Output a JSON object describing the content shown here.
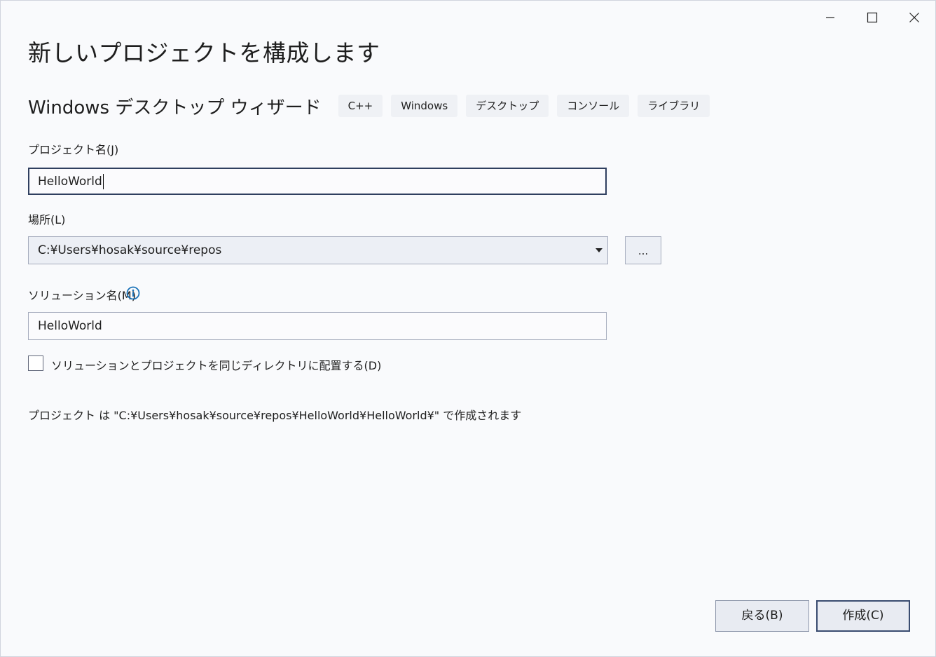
{
  "dialog": {
    "title": "新しいプロジェクトを構成します",
    "wizard_name": "Windows デスクトップ ウィザード",
    "tags": [
      "C++",
      "Windows",
      "デスクトップ",
      "コンソール",
      "ライブラリ"
    ]
  },
  "project_name": {
    "label": "プロジェクト名(J)",
    "value": "HelloWorld"
  },
  "location": {
    "label": "場所(L)",
    "value": "C:¥Users¥hosak¥source¥repos",
    "browse_label": "..."
  },
  "solution_name": {
    "label": "ソリューション名(M)",
    "value": "HelloWorld"
  },
  "same_directory": {
    "label": "ソリューションとプロジェクトを同じディレクトリに配置する(D)",
    "checked": false
  },
  "path_info": "プロジェクト は \"C:¥Users¥hosak¥source¥repos¥HelloWorld¥HelloWorld¥\" で作成されます",
  "buttons": {
    "back": "戻る(B)",
    "create": "作成(C)"
  },
  "icons": {
    "minimize": "minimize-icon",
    "maximize": "maximize-icon",
    "close": "close-icon",
    "info": "info-icon",
    "dropdown": "chevron-down-icon"
  },
  "colors": {
    "info_accent": "#1a72b8",
    "focus_border": "#2f3f5f"
  }
}
